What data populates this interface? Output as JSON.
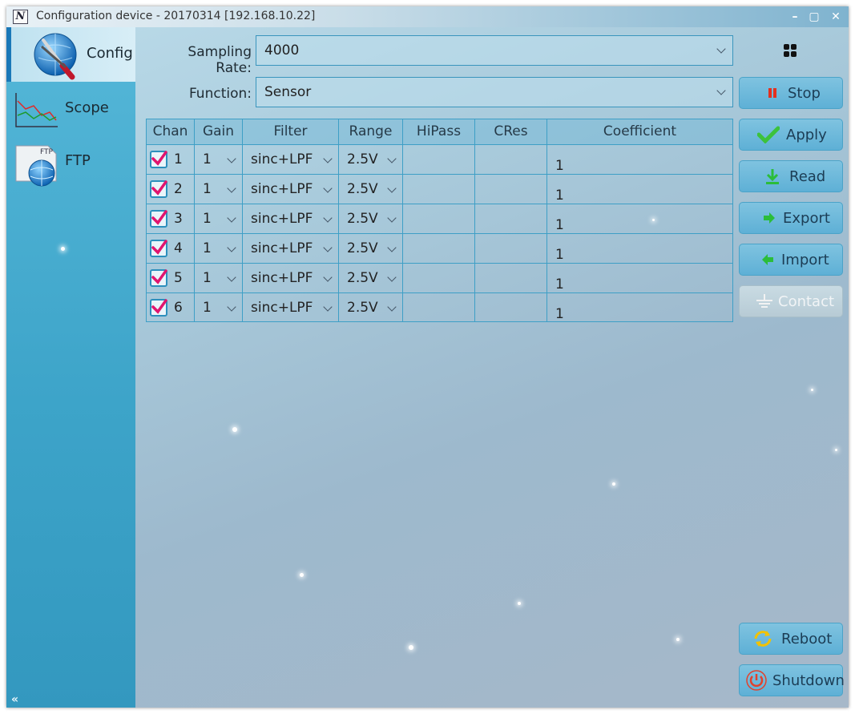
{
  "window": {
    "title": "Configuration device - 20170314 [192.168.10.22]",
    "controls": {
      "minimize": "–",
      "maximize": "▢",
      "close": "✕"
    }
  },
  "sidebar": {
    "items": [
      {
        "label": "Config",
        "icon": "config-tools-icon",
        "active": true
      },
      {
        "label": "Scope",
        "icon": "scope-chart-icon",
        "active": false
      },
      {
        "label": "FTP",
        "icon": "ftp-globe-icon",
        "active": false
      }
    ],
    "collapse": "«"
  },
  "form": {
    "sampling_rate_label": "Sampling Rate:",
    "sampling_rate_value": "4000",
    "function_label": "Function:",
    "function_value": "Sensor"
  },
  "table": {
    "headers": [
      "Chan",
      "Gain",
      "Filter",
      "Range",
      "HiPass",
      "CRes",
      "Coefficient"
    ],
    "rows": [
      {
        "checked": true,
        "chan": "1",
        "gain": "1",
        "filter": "sinc+LPF",
        "range": "2.5V",
        "hipass": "",
        "cres": "",
        "coef": "1"
      },
      {
        "checked": true,
        "chan": "2",
        "gain": "1",
        "filter": "sinc+LPF",
        "range": "2.5V",
        "hipass": "",
        "cres": "",
        "coef": "1"
      },
      {
        "checked": true,
        "chan": "3",
        "gain": "1",
        "filter": "sinc+LPF",
        "range": "2.5V",
        "hipass": "",
        "cres": "",
        "coef": "1"
      },
      {
        "checked": true,
        "chan": "4",
        "gain": "1",
        "filter": "sinc+LPF",
        "range": "2.5V",
        "hipass": "",
        "cres": "",
        "coef": "1"
      },
      {
        "checked": true,
        "chan": "5",
        "gain": "1",
        "filter": "sinc+LPF",
        "range": "2.5V",
        "hipass": "",
        "cres": "",
        "coef": "1"
      },
      {
        "checked": true,
        "chan": "6",
        "gain": "1",
        "filter": "sinc+LPF",
        "range": "2.5V",
        "hipass": "",
        "cres": "",
        "coef": "1"
      }
    ]
  },
  "buttons": {
    "stop": "Stop",
    "apply": "Apply",
    "read": "Read",
    "export": "Export",
    "import": "Import",
    "contact": "Contact",
    "reboot": "Reboot",
    "shutdown": "Shutdown"
  },
  "colors": {
    "accent": "#3e9fc6",
    "check": "#e0156f",
    "sidebar": "#3da4c9"
  }
}
